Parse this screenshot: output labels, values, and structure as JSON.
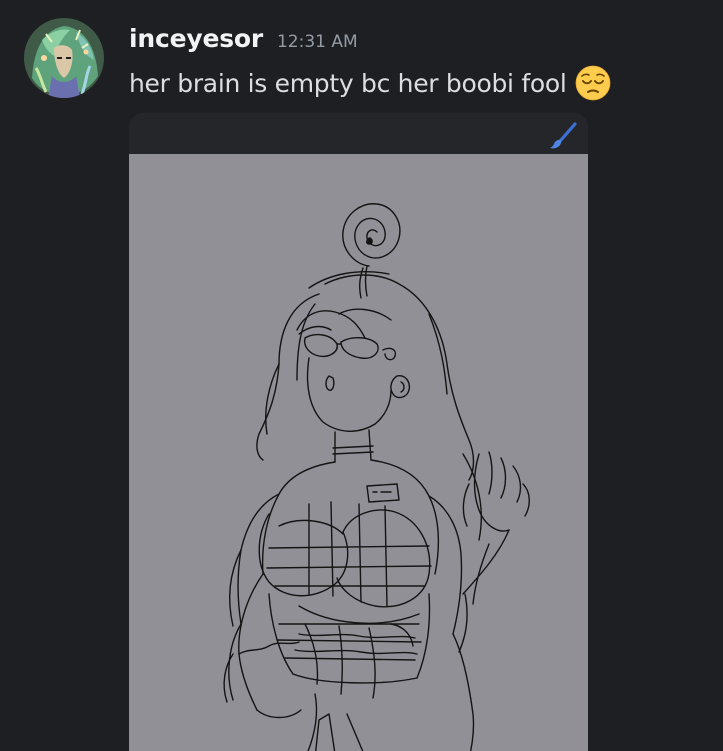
{
  "message": {
    "username": "inceyesor",
    "timestamp": "12:31 AM",
    "text": "her brain is empty bc her boobi fool",
    "emoji": "pensive-face-emoji"
  },
  "attachment": {
    "type": "image",
    "topbar_icon": "paintbrush-icon"
  },
  "colors": {
    "background": "#1e1f22",
    "username": "#f2f3f5",
    "timestamp": "#949ba4",
    "message_text": "#dbdee1",
    "canvas": "#919096",
    "brush_accent": "#3b6fd4"
  }
}
